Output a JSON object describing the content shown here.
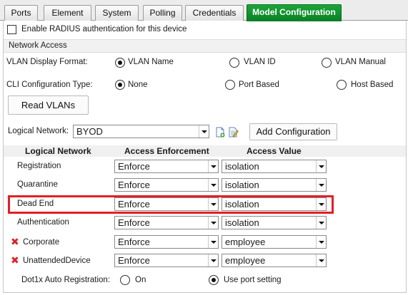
{
  "tabs": [
    "Ports",
    "Element",
    "System",
    "Polling",
    "Credentials",
    "Model Configuration"
  ],
  "active_tab": "Model Configuration",
  "radius_checkbox_label": "Enable RADIUS authentication for this device",
  "radius_checked": false,
  "network_access_title": "Network Access",
  "vlan_display": {
    "label": "VLAN Display Format:",
    "options": [
      "VLAN Name",
      "VLAN ID",
      "VLAN Manual"
    ],
    "selected": "VLAN Name"
  },
  "cli_config": {
    "label": "CLI Configuration Type:",
    "options": [
      "None",
      "Port Based",
      "Host Based"
    ],
    "selected": "None"
  },
  "read_vlans_button": "Read VLANs",
  "logical_network": {
    "label": "Logical Network:",
    "value": "BYOD",
    "add_button": "Add Configuration"
  },
  "table": {
    "headers": [
      "Logical Network",
      "Access Enforcement",
      "Access Value"
    ],
    "rows": [
      {
        "name": "Registration",
        "enforcement": "Enforce",
        "value": "isolation",
        "removable": false
      },
      {
        "name": "Quarantine",
        "enforcement": "Enforce",
        "value": "isolation",
        "removable": false
      },
      {
        "name": "Dead End",
        "enforcement": "Enforce",
        "value": "isolation",
        "removable": false
      },
      {
        "name": "Authentication",
        "enforcement": "Enforce",
        "value": "isolation",
        "removable": false
      },
      {
        "name": "Corporate",
        "enforcement": "Enforce",
        "value": "employee",
        "removable": true
      },
      {
        "name": "UnattendedDevice",
        "enforcement": "Enforce",
        "value": "employee",
        "removable": true
      }
    ],
    "highlighted_row": "Dead End"
  },
  "dot1x": {
    "label": "Dot1x Auto Registration:",
    "options": [
      "On",
      "Use port setting"
    ],
    "selected": "Use port setting"
  },
  "colors": {
    "active_tab": "#0f8a2a",
    "highlight": "#e02026",
    "delete": "#d8262b"
  },
  "icons": {
    "new_network": "new-document-icon",
    "edit_network": "edit-document-icon",
    "delete_row": "red-x-icon",
    "dropdown": "dropdown-arrow-icon"
  }
}
